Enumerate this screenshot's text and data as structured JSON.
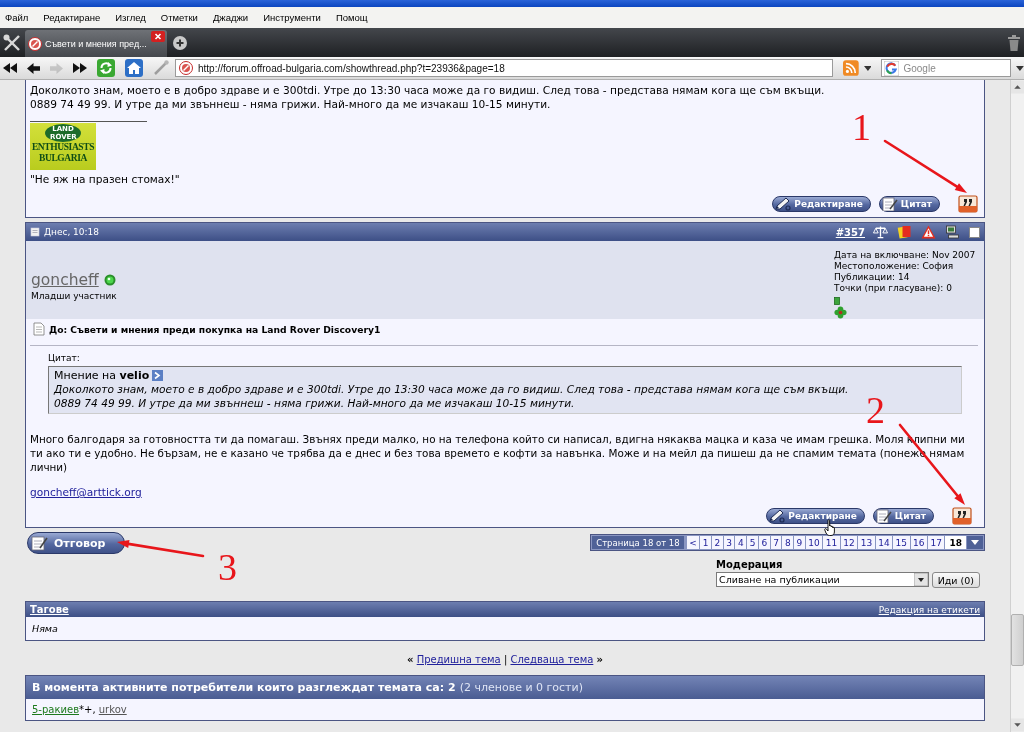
{
  "menu_bar": {
    "items": [
      "Файл",
      "Редактиране",
      "Изглед",
      "Отметки",
      "Джаджи",
      "Инструменти",
      "Помощ"
    ]
  },
  "tab_bar": {
    "tabs": [
      {
        "label": "Съвети и мнения пред...",
        "selected": true
      }
    ]
  },
  "address_bar": {
    "buttons": [
      {
        "kind": "rewind",
        "disabled": false
      },
      {
        "kind": "back",
        "disabled": false
      },
      {
        "kind": "forward",
        "disabled": true
      },
      {
        "kind": "fast_forward",
        "disabled": false
      },
      {
        "kind": "reload",
        "disabled": false
      },
      {
        "kind": "home",
        "disabled": false
      },
      {
        "kind": "wand",
        "disabled": true
      }
    ],
    "url": "http://forum.offroad-bulgaria.com/showthread.php?t=23936&page=18",
    "search_placeholder": "Google"
  },
  "previous_post": {
    "lines": [
      "Доколкото знам, моето е в добро здраве и е 300tdi. Утре до 13:30 часа може да го видиш. След това - представа нямам кога ще съм вкъщи.",
      "0889 74 49 99. И утре да ми звъннеш - няма грижи. Най-много да ме изчакаш 10-15 минути."
    ],
    "signature_logo": {
      "badge": "LAND ROVER",
      "lines": [
        "ENTHUSIASTS",
        "BULGARIA"
      ]
    },
    "signature_text": "\"Не яж на празен стомах!\"",
    "buttons": [
      {
        "kind": "edit",
        "label": "Редактиране"
      },
      {
        "kind": "quote",
        "label": "Цитат"
      }
    ]
  },
  "post": {
    "date": "Днес, 10:18",
    "number": "#357",
    "checked": false,
    "username": "goncheff",
    "online": true,
    "rank": "Младши участник",
    "details": [
      "Дата на включване: Nov 2007",
      "Местоположение: София",
      "Публикации: 14",
      "Точки (при гласуване): 0"
    ],
    "title": "До: Съвети и мнения преди покупка на Land Rover Discovery1",
    "quote": {
      "label": "Цитат:",
      "author_line": "Мнение на **velio**",
      "lines": [
        "Доколкото знам, моето е в добро здраве и е 300tdi. Утре до 13:30 часа може да го видиш. След това - представа нямам кога ще съм вкъщи.",
        "0889 74 49 99. И утре да ми звъннеш - няма грижи. Най-много да ме изчакаш 10-15 минути."
      ]
    },
    "message": "Много балгодаря за готовността ти да помагаш. Звънях преди малко, но на телефона който си написал, вдигна някаква мацка и каза че имам грешка. Моля клипни ми ти ако ти е удобно. Не бързам, не е казано че трябва да е днес и без това времето е кофти за навънка. Може и на мейл да пишеш да не спамим темата (понеже нямам лични)",
    "email": "goncheff@arttick.org",
    "buttons": [
      {
        "kind": "edit",
        "label": "Редактиране"
      },
      {
        "kind": "quote",
        "label": "Цитат"
      }
    ]
  },
  "reply_button": "Отговор",
  "pagination": {
    "label": "Страница 18 от 18",
    "prev": "<",
    "pages": [
      {
        "label": "1",
        "selected": false
      },
      {
        "label": "2",
        "selected": false
      },
      {
        "label": "3",
        "selected": false
      },
      {
        "label": "4",
        "selected": false
      },
      {
        "label": "5",
        "selected": false
      },
      {
        "label": "6",
        "selected": false
      },
      {
        "label": "7",
        "selected": false
      },
      {
        "label": "8",
        "selected": false
      },
      {
        "label": "9",
        "selected": false
      },
      {
        "label": "10",
        "selected": false
      },
      {
        "label": "11",
        "selected": false
      },
      {
        "label": "12",
        "selected": false
      },
      {
        "label": "13",
        "selected": false
      },
      {
        "label": "14",
        "selected": false
      },
      {
        "label": "15",
        "selected": false
      },
      {
        "label": "16",
        "selected": false
      },
      {
        "label": "17",
        "selected": false
      },
      {
        "label": "18",
        "selected": true
      }
    ]
  },
  "moderation": {
    "title": "Модерация",
    "selected_option": "Сливане на публикации",
    "button": "Иди (0)"
  },
  "tags": {
    "title": "Тагове",
    "edit_link": "Редакция на етикети",
    "text": "Няма"
  },
  "thread_nav": {
    "prev_mark": "«",
    "prev": "Предишна тема",
    "separator": "|",
    "next": "Следваща тема",
    "next_mark": "»"
  },
  "active_users": {
    "heading": "В момента активните потребители които разглеждат темата са: **2**",
    "note": "(2 членове и 0 гости)",
    "separator": ", ",
    "users": [
      {
        "name": "5-ракиев",
        "suffix": "*+",
        "color": "#1e7a1e"
      },
      {
        "name": "urkov",
        "color": "#555555"
      }
    ]
  },
  "annotations": [
    {
      "label": "1"
    },
    {
      "label": "2"
    },
    {
      "label": "3"
    }
  ]
}
